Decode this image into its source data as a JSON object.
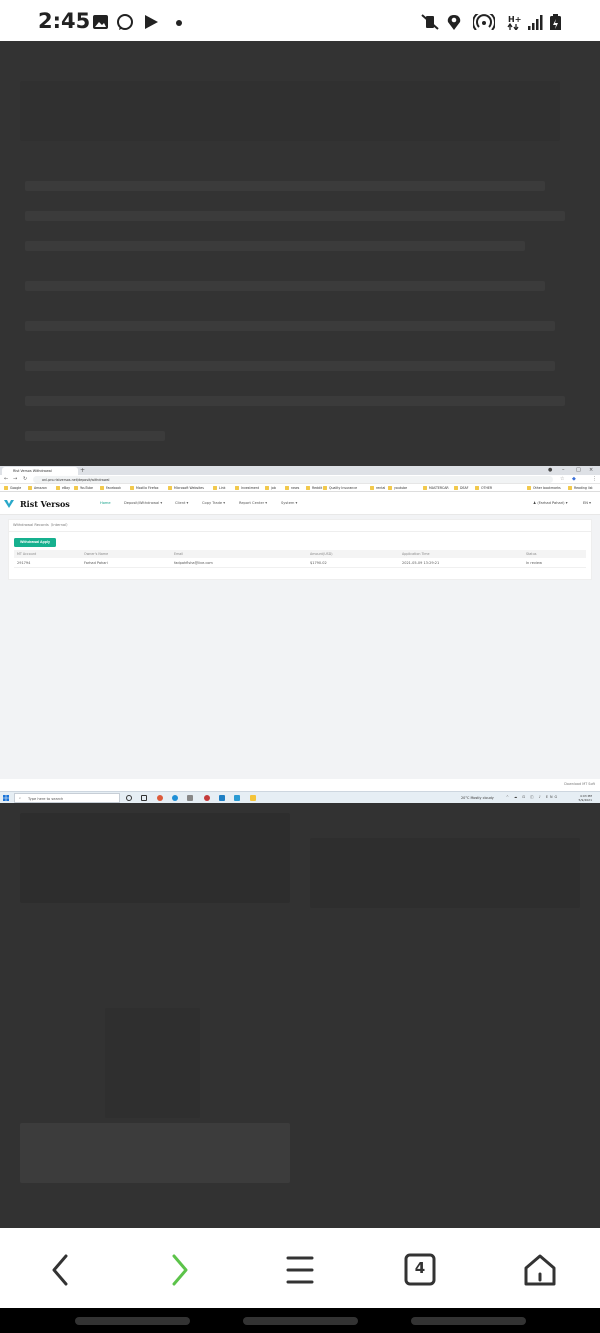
{
  "status_bar": {
    "time": "2:45"
  },
  "browser_tab": {
    "title": "Rist Versos Withdrawal"
  },
  "address": {
    "url": "onl.pro.ristversos.net/deposit/withdrawal"
  },
  "bookmarks": [
    "Google",
    "Amazon",
    "eBay",
    "YouTube",
    "Facebook",
    "Mozilla Firefox",
    "Microsoft Websites",
    "Link",
    "Investment",
    "job",
    "news",
    "Reddit",
    "Quality Insurance",
    "rental",
    "youtube",
    "MASTERCAR",
    "DEAF",
    "OTHER",
    "Other bookmarks",
    "Reading list"
  ],
  "app": {
    "brand": "Rist Versos",
    "nav": [
      "Home",
      "Deposit/Withdrawal ▾",
      "Client ▾",
      "Copy Trade ▾",
      "Report Center ▾",
      "System ▾"
    ],
    "user": "♟ (Farhad Pahari) ▾",
    "lang": "EN ▾"
  },
  "panel": {
    "title": "Withdrawal Records（Internal）",
    "apply_button": "Withdrawal Apply",
    "columns": [
      "MT Account",
      "Owner's Name",
      "Email",
      "Amount(USD)",
      "Application Time",
      "Status"
    ],
    "rows": [
      {
        "account": "291794",
        "name": "Farhad Pahari",
        "email": "fadpahflsha@live.com",
        "amount": "$1790.02",
        "time": "2021-05-09 13:29:21",
        "status": "In review"
      }
    ]
  },
  "download_link": "Download MT Soft",
  "taskbar": {
    "search_placeholder": "Type here to search",
    "weather": "20°C  Mostly cloudy",
    "tray": "^ ☁ ⊡ ◫ ♪ ENG",
    "clock_time": "4:03 PM",
    "clock_date": "5/9/2021"
  },
  "bottom_nav": {
    "tabs_count": "4"
  },
  "colors": {
    "accent": "#16b08e",
    "active_nav": "#16a28a",
    "forward_arrow": "#5cc34a"
  }
}
